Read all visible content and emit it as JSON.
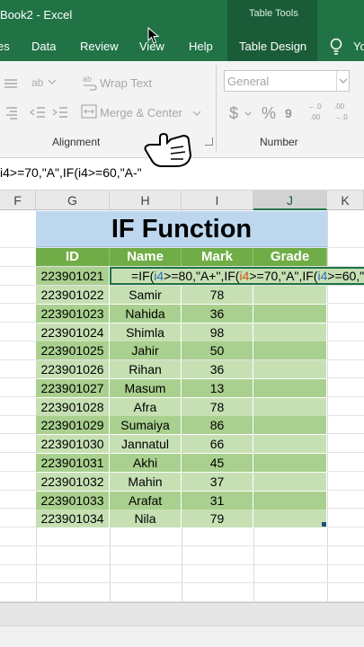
{
  "window": {
    "title": "Book2  -  Excel",
    "context_tab_group": "Table Tools"
  },
  "ribbon_tabs": [
    {
      "label": "es"
    },
    {
      "label": "Data"
    },
    {
      "label": "Review"
    },
    {
      "label": "View"
    },
    {
      "label": "Help"
    },
    {
      "label": "Table Design"
    },
    {
      "label": "Yo"
    }
  ],
  "ribbon": {
    "wrap_text": "Wrap Text",
    "merge_center": "Merge & Center",
    "alignment_label": "Alignment",
    "number_format": "General",
    "number_label": "Number",
    "currency_symbol": "$",
    "percent_symbol": "%",
    "increase_decimal": ".00\n→.0",
    "decrease_decimal": ".0\n→.00"
  },
  "formula_bar": {
    "text": "i4>=70,\"A\",IF(i4>=60,\"A-\""
  },
  "columns": [
    "F",
    "G",
    "H",
    "I",
    "J",
    "K"
  ],
  "sheet_title": "IF Function",
  "table": {
    "headers": [
      "ID",
      "Name",
      "Mark",
      "Grade"
    ],
    "formula_row": {
      "id": "223901021",
      "formula_parts": [
        {
          "t": "=IF(",
          "c": "black"
        },
        {
          "t": "i4",
          "c": "blue"
        },
        {
          "t": ">=80,\"A+\",IF(",
          "c": "black"
        },
        {
          "t": "i4",
          "c": "orange"
        },
        {
          "t": ">=70,\"A\",IF(",
          "c": "black"
        },
        {
          "t": "i4",
          "c": "blue"
        },
        {
          "t": ">=60,\"",
          "c": "black"
        }
      ]
    },
    "rows": [
      {
        "id": "223901022",
        "name": "Samir",
        "mark": "78"
      },
      {
        "id": "223901023",
        "name": "Nahida",
        "mark": "36"
      },
      {
        "id": "223901024",
        "name": "Shimla",
        "mark": "98"
      },
      {
        "id": "223901025",
        "name": "Jahir",
        "mark": "50"
      },
      {
        "id": "223901026",
        "name": "Rihan",
        "mark": "36"
      },
      {
        "id": "223901027",
        "name": "Masum",
        "mark": "13"
      },
      {
        "id": "223901028",
        "name": "Afra",
        "mark": "78"
      },
      {
        "id": "223901029",
        "name": "Sumaiya",
        "mark": "86"
      },
      {
        "id": "223901030",
        "name": "Jannatul",
        "mark": "66"
      },
      {
        "id": "223901031",
        "name": "Akhi",
        "mark": "45"
      },
      {
        "id": "223901032",
        "name": "Mahin",
        "mark": "37"
      },
      {
        "id": "223901033",
        "name": "Arafat",
        "mark": "31"
      },
      {
        "id": "223901034",
        "name": "Nila",
        "mark": "79"
      }
    ]
  },
  "colors": {
    "excel_green": "#217346",
    "title_fill": "#bdd7ee",
    "header_fill": "#70ad47",
    "row_dark": "#a9d08e",
    "row_light": "#c6e0b4"
  }
}
